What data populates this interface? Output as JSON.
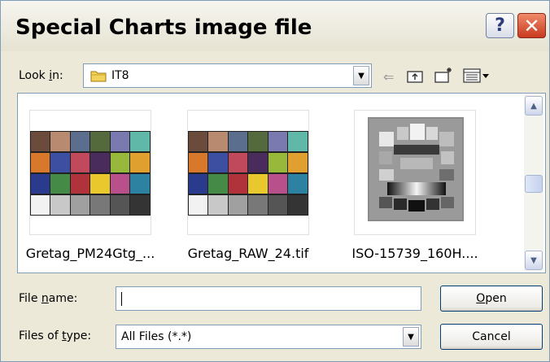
{
  "window": {
    "title": "Special Charts image file",
    "help_label": "?",
    "close_label": "✕"
  },
  "lookin": {
    "label_pre": "Look ",
    "label_accel": "i",
    "label_post": "n:",
    "value": "IT8"
  },
  "toolbar": {
    "back_icon": "back-arrow-icon",
    "up_icon": "up-folder-icon",
    "new_folder_icon": "new-folder-icon",
    "view_icon": "view-menu-icon"
  },
  "files": [
    {
      "name": "Gretag_PM24Gtg_...",
      "thumb": "colorchecker"
    },
    {
      "name": "Gretag_RAW_24.tif",
      "thumb": "colorchecker"
    },
    {
      "name": "ISO-15739_160H....",
      "thumb": "iso-chart"
    }
  ],
  "filename": {
    "label_pre": "File ",
    "label_accel": "n",
    "label_post": "ame:",
    "value": ""
  },
  "filetype": {
    "label_pre": "Files of ",
    "label_accel": "t",
    "label_post": "ype:",
    "value": "All Files (*.*)"
  },
  "buttons": {
    "open_accel": "O",
    "open_rest": "pen",
    "cancel": "Cancel"
  },
  "colors": {
    "dialog_bg": "#ece9d8",
    "border": "#7f9db9",
    "close_red": "#c83a1e"
  }
}
